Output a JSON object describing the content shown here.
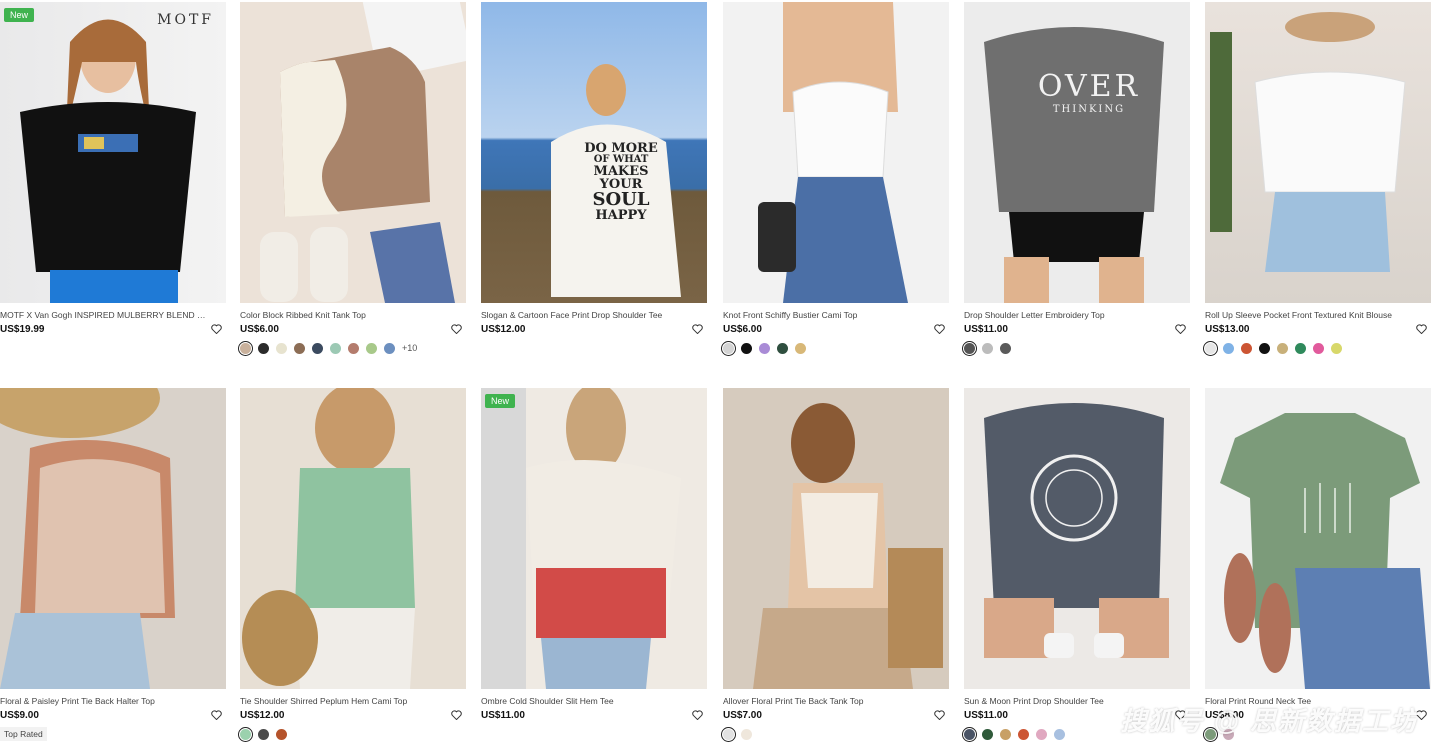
{
  "products": [
    {
      "title": "MOTF X Van Gogh INSPIRED MULBERRY BLEND SIL...",
      "price": "US$19.99",
      "badge": "New",
      "logo": "MOTF",
      "swatches": [],
      "more": ""
    },
    {
      "title": "Color Block Ribbed Knit Tank Top",
      "price": "US$6.00",
      "badge": "",
      "swatches": [
        "#c9b19c",
        "#2b2b2b",
        "#e7e3cf",
        "#8c6d55",
        "#3b4a5f",
        "#9cc9b4",
        "#b47c6d",
        "#a8c98a",
        "#6c8fbf"
      ],
      "more": "+10"
    },
    {
      "title": "Slogan & Cartoon Face Print Drop Shoulder Tee",
      "price": "US$12.00",
      "badge": "",
      "swatches": [],
      "more": "",
      "shirt_lines": [
        "DO MORE",
        "OF WHAT",
        "MAKES",
        "YOUR",
        "SOUL",
        "HAPPY"
      ]
    },
    {
      "title": "Knot Front Schiffy Bustier Cami Top",
      "price": "US$6.00",
      "badge": "",
      "swatches": [
        "#d4d4d4",
        "#111111",
        "#a98bd6",
        "#2f4f3f",
        "#d8b878"
      ],
      "more": ""
    },
    {
      "title": "Drop Shoulder Letter Embroidery Top",
      "price": "US$11.00",
      "badge": "",
      "swatches": [
        "#555555",
        "#bcbcbc",
        "#5a5a5a"
      ],
      "more": "",
      "shirt_lines": [
        "OVER",
        "THINKING"
      ]
    },
    {
      "title": "Roll Up Sleeve Pocket Front Textured Knit Blouse",
      "price": "US$13.00",
      "badge": "",
      "swatches": [
        "#e6e6e6",
        "#7fb2e6",
        "#cc5533",
        "#111111",
        "#c8b07a",
        "#2f8a5c",
        "#e15a9c",
        "#d8d86a"
      ],
      "more": ""
    },
    {
      "title": "Floral & Paisley Print Tie Back Halter Top",
      "price": "US$9.00",
      "badge": "",
      "swatches": [],
      "more": "",
      "tag": "Top Rated"
    },
    {
      "title": "Tie Shoulder Shirred Peplum Hem Cami Top",
      "price": "US$12.00",
      "badge": "",
      "swatches": [
        "#9bd1ad",
        "#4a4a4a",
        "#b5532b"
      ],
      "more": ""
    },
    {
      "title": "Ombre Cold Shoulder Slit Hem Tee",
      "price": "US$11.00",
      "badge": "New",
      "swatches": [],
      "more": ""
    },
    {
      "title": "Allover Floral Print Tie Back Tank Top",
      "price": "US$7.00",
      "badge": "",
      "swatches": [
        "#e2e2e2",
        "#efe7dc"
      ],
      "more": ""
    },
    {
      "title": "Sun & Moon Print Drop Shoulder Tee",
      "price": "US$11.00",
      "badge": "",
      "swatches": [
        "#4a5466",
        "#2f5a3a",
        "#c8a066",
        "#cc5533",
        "#e0a8c0",
        "#a8c0e0"
      ],
      "more": ""
    },
    {
      "title": "Floral Print Round Neck Tee",
      "price": "US$8.00",
      "badge": "",
      "swatches": [
        "#7c9b7a",
        "#c9aab8"
      ],
      "more": ""
    }
  ],
  "watermark": "搜狐号 @ 思新数据工坊",
  "colors": {
    "badge": "#3fb34f"
  },
  "icons": {
    "wishlist": "heart-outline-icon"
  }
}
